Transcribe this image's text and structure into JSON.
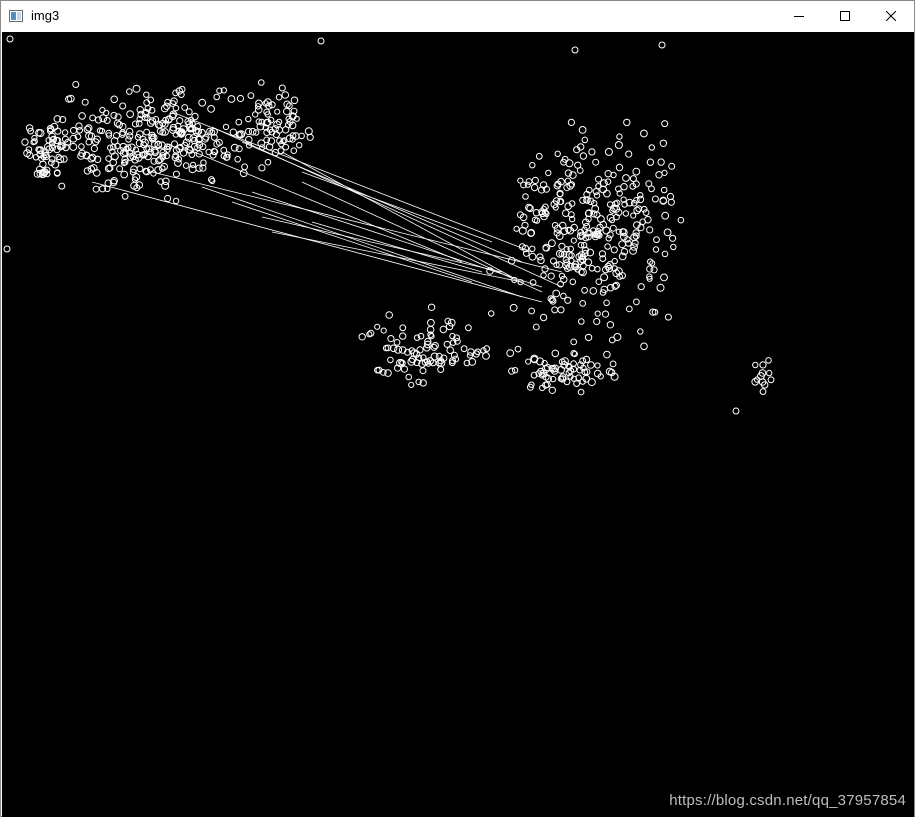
{
  "window": {
    "title": "img3",
    "app_icon": "opencv-window-icon",
    "controls": {
      "minimize_icon": "minimize-icon",
      "maximize_icon": "maximize-icon",
      "close_icon": "close-icon"
    }
  },
  "image": {
    "background_color": "#000000",
    "marker_color": "#ffffff",
    "marker_shape": "circle",
    "content": "keypoint-matches"
  },
  "watermark": {
    "text": "https://blog.csdn.net/qq_37957854"
  }
}
